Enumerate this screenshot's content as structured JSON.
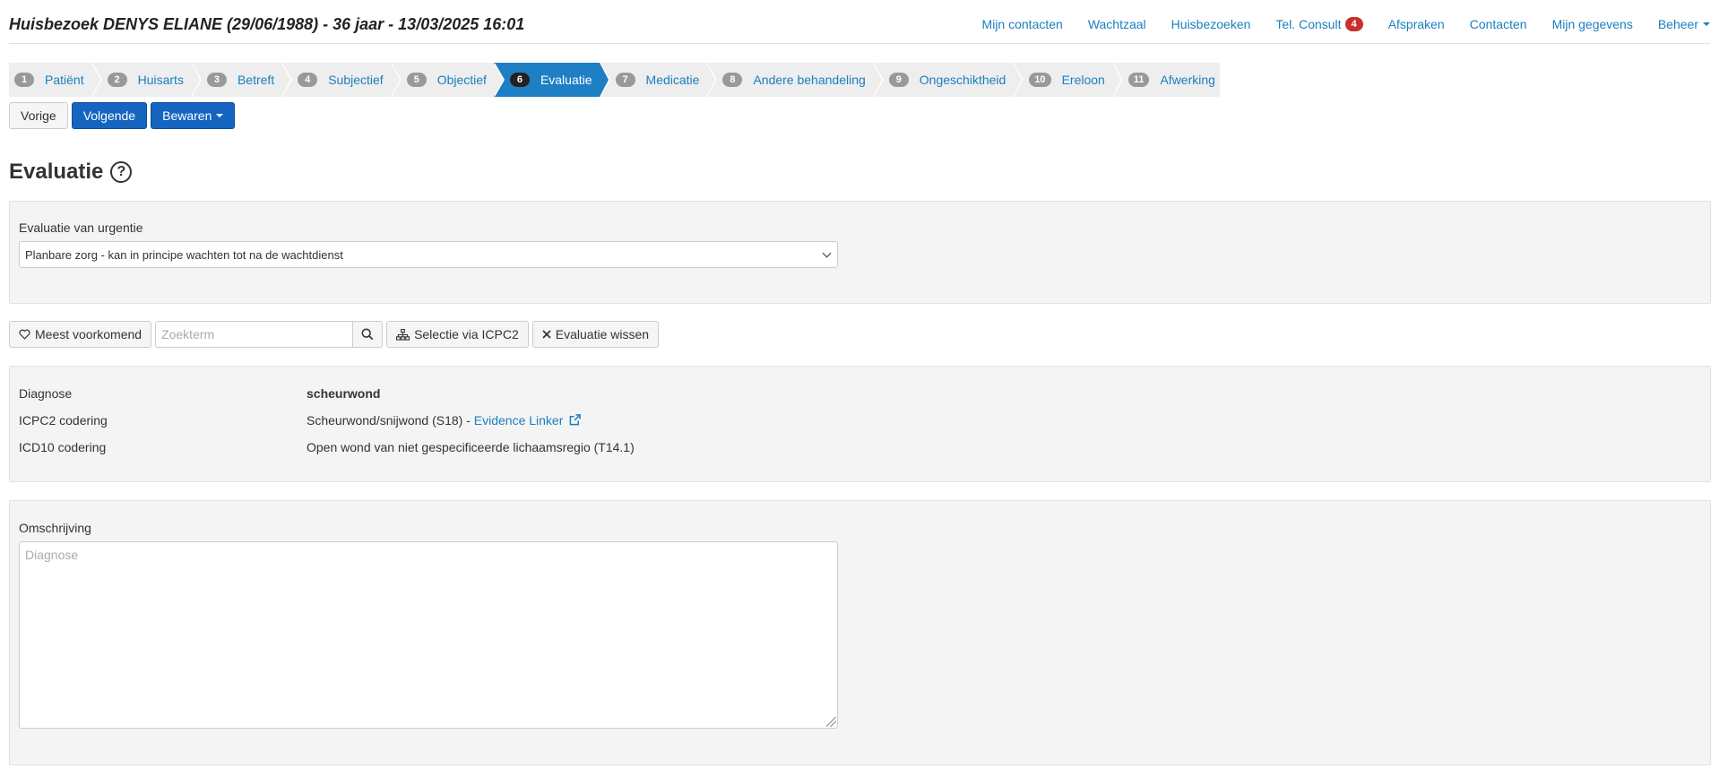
{
  "header": {
    "title": "Huisbezoek DENYS ELIANE (29/06/1988) - 36 jaar - 13/03/2025 16:01",
    "nav": [
      {
        "label": "Mijn contacten"
      },
      {
        "label": "Wachtzaal"
      },
      {
        "label": "Huisbezoeken"
      },
      {
        "label": "Tel. Consult",
        "badge": "4"
      },
      {
        "label": "Afspraken"
      },
      {
        "label": "Contacten"
      },
      {
        "label": "Mijn gegevens"
      },
      {
        "label": "Beheer"
      }
    ]
  },
  "steps": [
    {
      "num": "1",
      "label": "Patiënt"
    },
    {
      "num": "2",
      "label": "Huisarts"
    },
    {
      "num": "3",
      "label": "Betreft"
    },
    {
      "num": "4",
      "label": "Subjectief"
    },
    {
      "num": "5",
      "label": "Objectief"
    },
    {
      "num": "6",
      "label": "Evaluatie",
      "active": true
    },
    {
      "num": "7",
      "label": "Medicatie"
    },
    {
      "num": "8",
      "label": "Andere behandeling"
    },
    {
      "num": "9",
      "label": "Ongeschiktheid"
    },
    {
      "num": "10",
      "label": "Ereloon"
    },
    {
      "num": "11",
      "label": "Afwerking"
    }
  ],
  "buttons": {
    "prev": "Vorige",
    "next": "Volgende",
    "save": "Bewaren"
  },
  "section_title": "Evaluatie",
  "urgency": {
    "label": "Evaluatie van urgentie",
    "value": "Planbare zorg - kan in principe wachten tot na de wachtdienst"
  },
  "toolbar": {
    "frequent": "Meest voorkomend",
    "search_placeholder": "Zoekterm",
    "icpc_select": "Selectie via ICPC2",
    "clear": "Evaluatie wissen"
  },
  "diagnosis": {
    "diag_label": "Diagnose",
    "diag_value": "scheurwond",
    "icpc_label": "ICPC2 codering",
    "icpc_value": "Scheurwond/snijwond (S18) - ",
    "icpc_link": "Evidence Linker",
    "icd_label": "ICD10 codering",
    "icd_value": "Open wond van niet gespecificeerde lichaamsregio (T14.1)"
  },
  "description": {
    "label": "Omschrijving",
    "placeholder": "Diagnose"
  },
  "colors": {
    "accent": "#1e7fc4",
    "primary_button": "#1565c0",
    "badge": "#c9302c",
    "link": "#1a7fbf"
  }
}
